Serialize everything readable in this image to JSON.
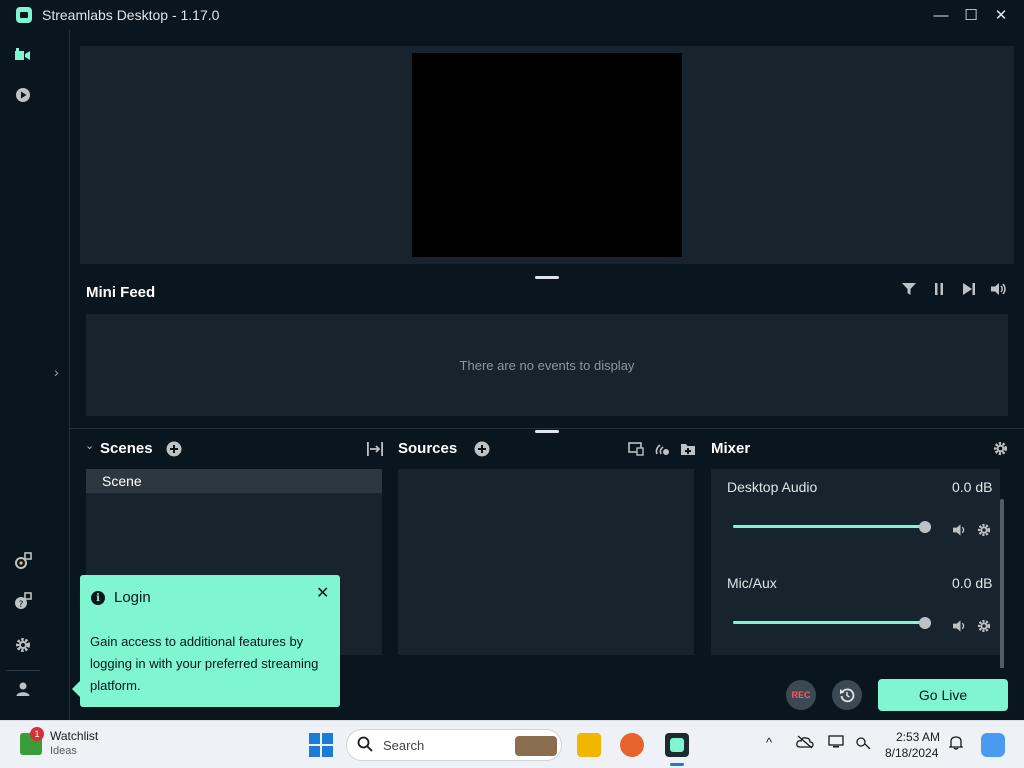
{
  "window": {
    "title": "Streamlabs Desktop - 1.17.0",
    "minimize": "—",
    "maximize": "☐",
    "close": "✕"
  },
  "nav": {
    "icons": [
      "editor-icon",
      "play-icon",
      "link-icon",
      "help-icon",
      "settings-icon",
      "user-icon"
    ],
    "collapse_arrow": "›"
  },
  "mini_feed": {
    "title": "Mini Feed",
    "empty_message": "There are no events to display"
  },
  "scenes": {
    "title": "Scenes",
    "items": [
      {
        "label": "Scene"
      }
    ]
  },
  "sources": {
    "title": "Sources"
  },
  "mixer": {
    "title": "Mixer",
    "channels": [
      {
        "name": "Desktop Audio",
        "db": "0.0 dB",
        "level": 1.0
      },
      {
        "name": "Mic/Aux",
        "db": "0.0 dB",
        "level": 1.0
      }
    ]
  },
  "footer": {
    "rec_label": "REC",
    "go_live_label": "Go Live"
  },
  "login_tooltip": {
    "title": "Login",
    "info_glyph": "i",
    "close_glyph": "✕",
    "body": "Gain access to additional features by logging in with your preferred streaming platform."
  },
  "taskbar": {
    "widget_badge": "1",
    "widget_title": "Watchlist",
    "widget_subtitle": "Ideas",
    "search_placeholder": "Search",
    "time": "2:53 AM",
    "date": "8/18/2024"
  },
  "colors": {
    "accent": "#80f5d2",
    "background": "#09161d",
    "panel": "#17242d"
  }
}
